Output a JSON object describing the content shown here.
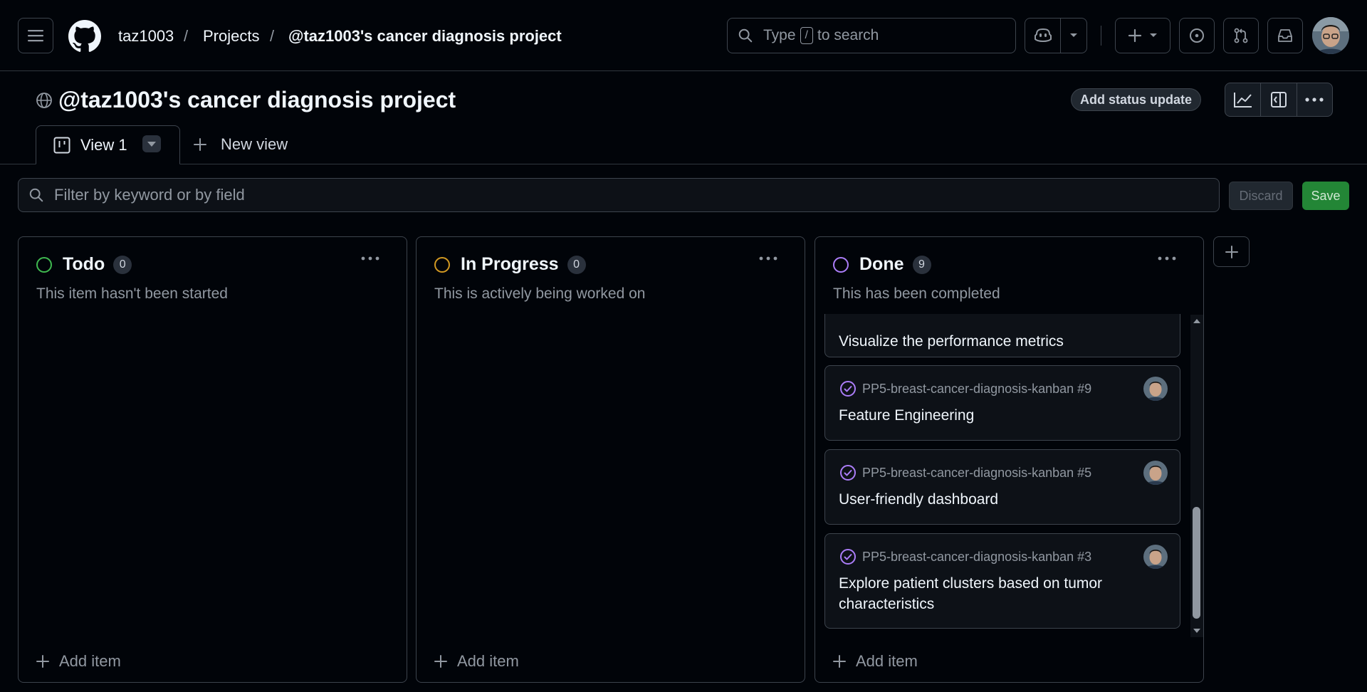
{
  "header": {
    "user": "taz1003",
    "projects": "Projects",
    "project": "@taz1003's cancer diagnosis project",
    "search_prefix": "Type",
    "search_key": "/",
    "search_suffix": "to search"
  },
  "project": {
    "title": "@taz1003's cancer diagnosis project",
    "status_button": "Add status update"
  },
  "tabs": {
    "active": "View 1",
    "new_view": "New view"
  },
  "filter": {
    "placeholder": "Filter by keyword or by field",
    "discard": "Discard",
    "save": "Save"
  },
  "columns": [
    {
      "name": "Todo",
      "count": "0",
      "description": "This item hasn't been started",
      "color": "#3fb950",
      "add": "Add item"
    },
    {
      "name": "In Progress",
      "count": "0",
      "description": "This is actively being worked on",
      "color": "#d29922",
      "add": "Add item"
    },
    {
      "name": "Done",
      "count": "9",
      "description": "This has been completed",
      "color": "#ab7df8",
      "add": "Add item"
    }
  ],
  "done_cards": [
    {
      "title": "Visualize the performance metrics"
    },
    {
      "repo": "PP5-breast-cancer-diagnosis-kanban #9",
      "title": "Feature Engineering"
    },
    {
      "repo": "PP5-breast-cancer-diagnosis-kanban #5",
      "title": "User-friendly dashboard"
    },
    {
      "repo": "PP5-breast-cancer-diagnosis-kanban #3",
      "title": "Explore patient clusters based on tumor characteristics"
    }
  ],
  "colors": {
    "background": "#010409",
    "border": "#3d444d",
    "done_purple": "#ab7df8",
    "save_green": "#238636"
  }
}
